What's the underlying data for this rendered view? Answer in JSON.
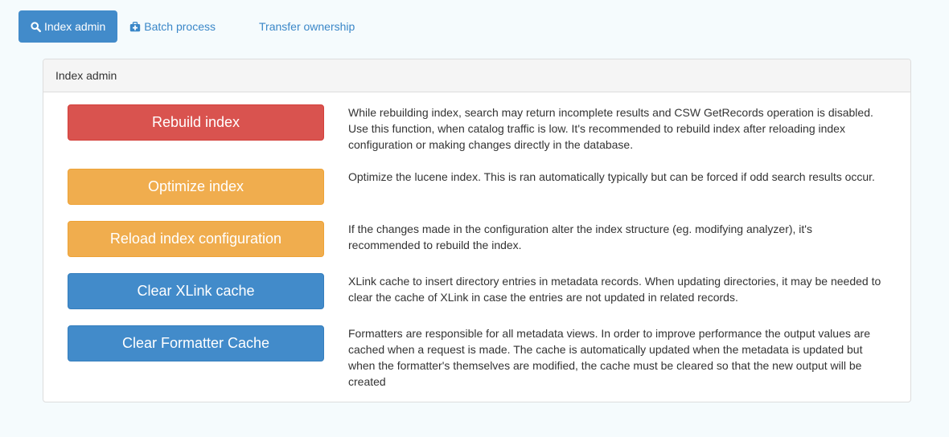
{
  "tabs": [
    {
      "label": "Index admin",
      "icon": "search-icon",
      "active": true
    },
    {
      "label": "Batch process",
      "icon": "medkit-icon",
      "active": false
    },
    {
      "label": "Transfer ownership",
      "icon": "",
      "active": false
    }
  ],
  "panel": {
    "title": "Index admin",
    "actions": [
      {
        "label": "Rebuild index",
        "style": "danger",
        "description": "While rebuilding index, search may return incomplete results and CSW GetRecords operation is disabled. Use this function, when catalog traffic is low. It's recommended to rebuild index after reloading index configuration or making changes directly in the database."
      },
      {
        "label": "Optimize index",
        "style": "warning",
        "description": "Optimize the lucene index. This is ran automatically typically but can be forced if odd search results occur."
      },
      {
        "label": "Reload index configuration",
        "style": "warning",
        "description": "If the changes made in the configuration alter the index structure (eg. modifying analyzer), it's recommended to rebuild the index."
      },
      {
        "label": "Clear XLink cache",
        "style": "primary",
        "description": "XLink cache to insert directory entries in metadata records. When updating directories, it may be needed to clear the cache of XLink in case the entries are not updated in related records."
      },
      {
        "label": "Clear Formatter Cache",
        "style": "primary",
        "description": "Formatters are responsible for all metadata views. In order to improve performance the output values are cached when a request is made. The cache is automatically updated when the metadata is updated but when the formatter's themselves are modified, the cache must be cleared so that the new output will be created"
      }
    ]
  },
  "colors": {
    "danger": "#d9534f",
    "warning": "#f0ad4e",
    "primary": "#428bca",
    "link": "#3a87c8"
  }
}
